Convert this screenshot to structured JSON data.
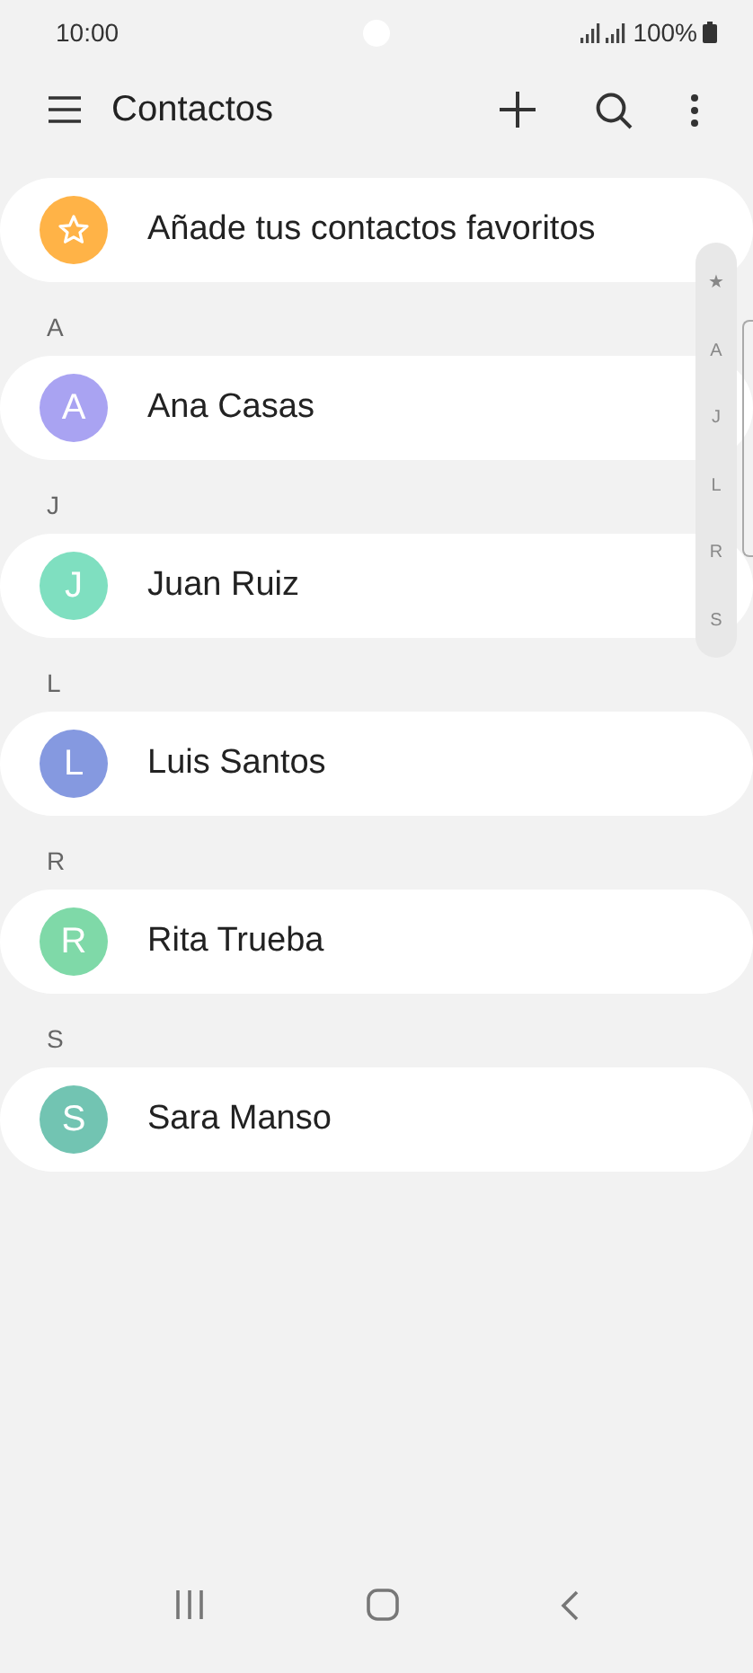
{
  "status_bar": {
    "time": "10:00",
    "battery": "100%"
  },
  "header": {
    "title": "Contactos"
  },
  "favorites": {
    "label": "Añade tus contactos favoritos"
  },
  "sections": [
    {
      "letter": "A",
      "contacts": [
        {
          "initial": "A",
          "name": "Ana Casas",
          "color": "#a9a3f2"
        }
      ]
    },
    {
      "letter": "J",
      "contacts": [
        {
          "initial": "J",
          "name": "Juan Ruiz",
          "color": "#7fdfc0"
        }
      ]
    },
    {
      "letter": "L",
      "contacts": [
        {
          "initial": "L",
          "name": "Luis Santos",
          "color": "#8599e0"
        }
      ]
    },
    {
      "letter": "R",
      "contacts": [
        {
          "initial": "R",
          "name": "Rita Trueba",
          "color": "#7fd9a8"
        }
      ]
    },
    {
      "letter": "S",
      "contacts": [
        {
          "initial": "S",
          "name": "Sara Manso",
          "color": "#72c4b2"
        }
      ]
    }
  ],
  "index": [
    "★",
    "A",
    "J",
    "L",
    "R",
    "S"
  ]
}
